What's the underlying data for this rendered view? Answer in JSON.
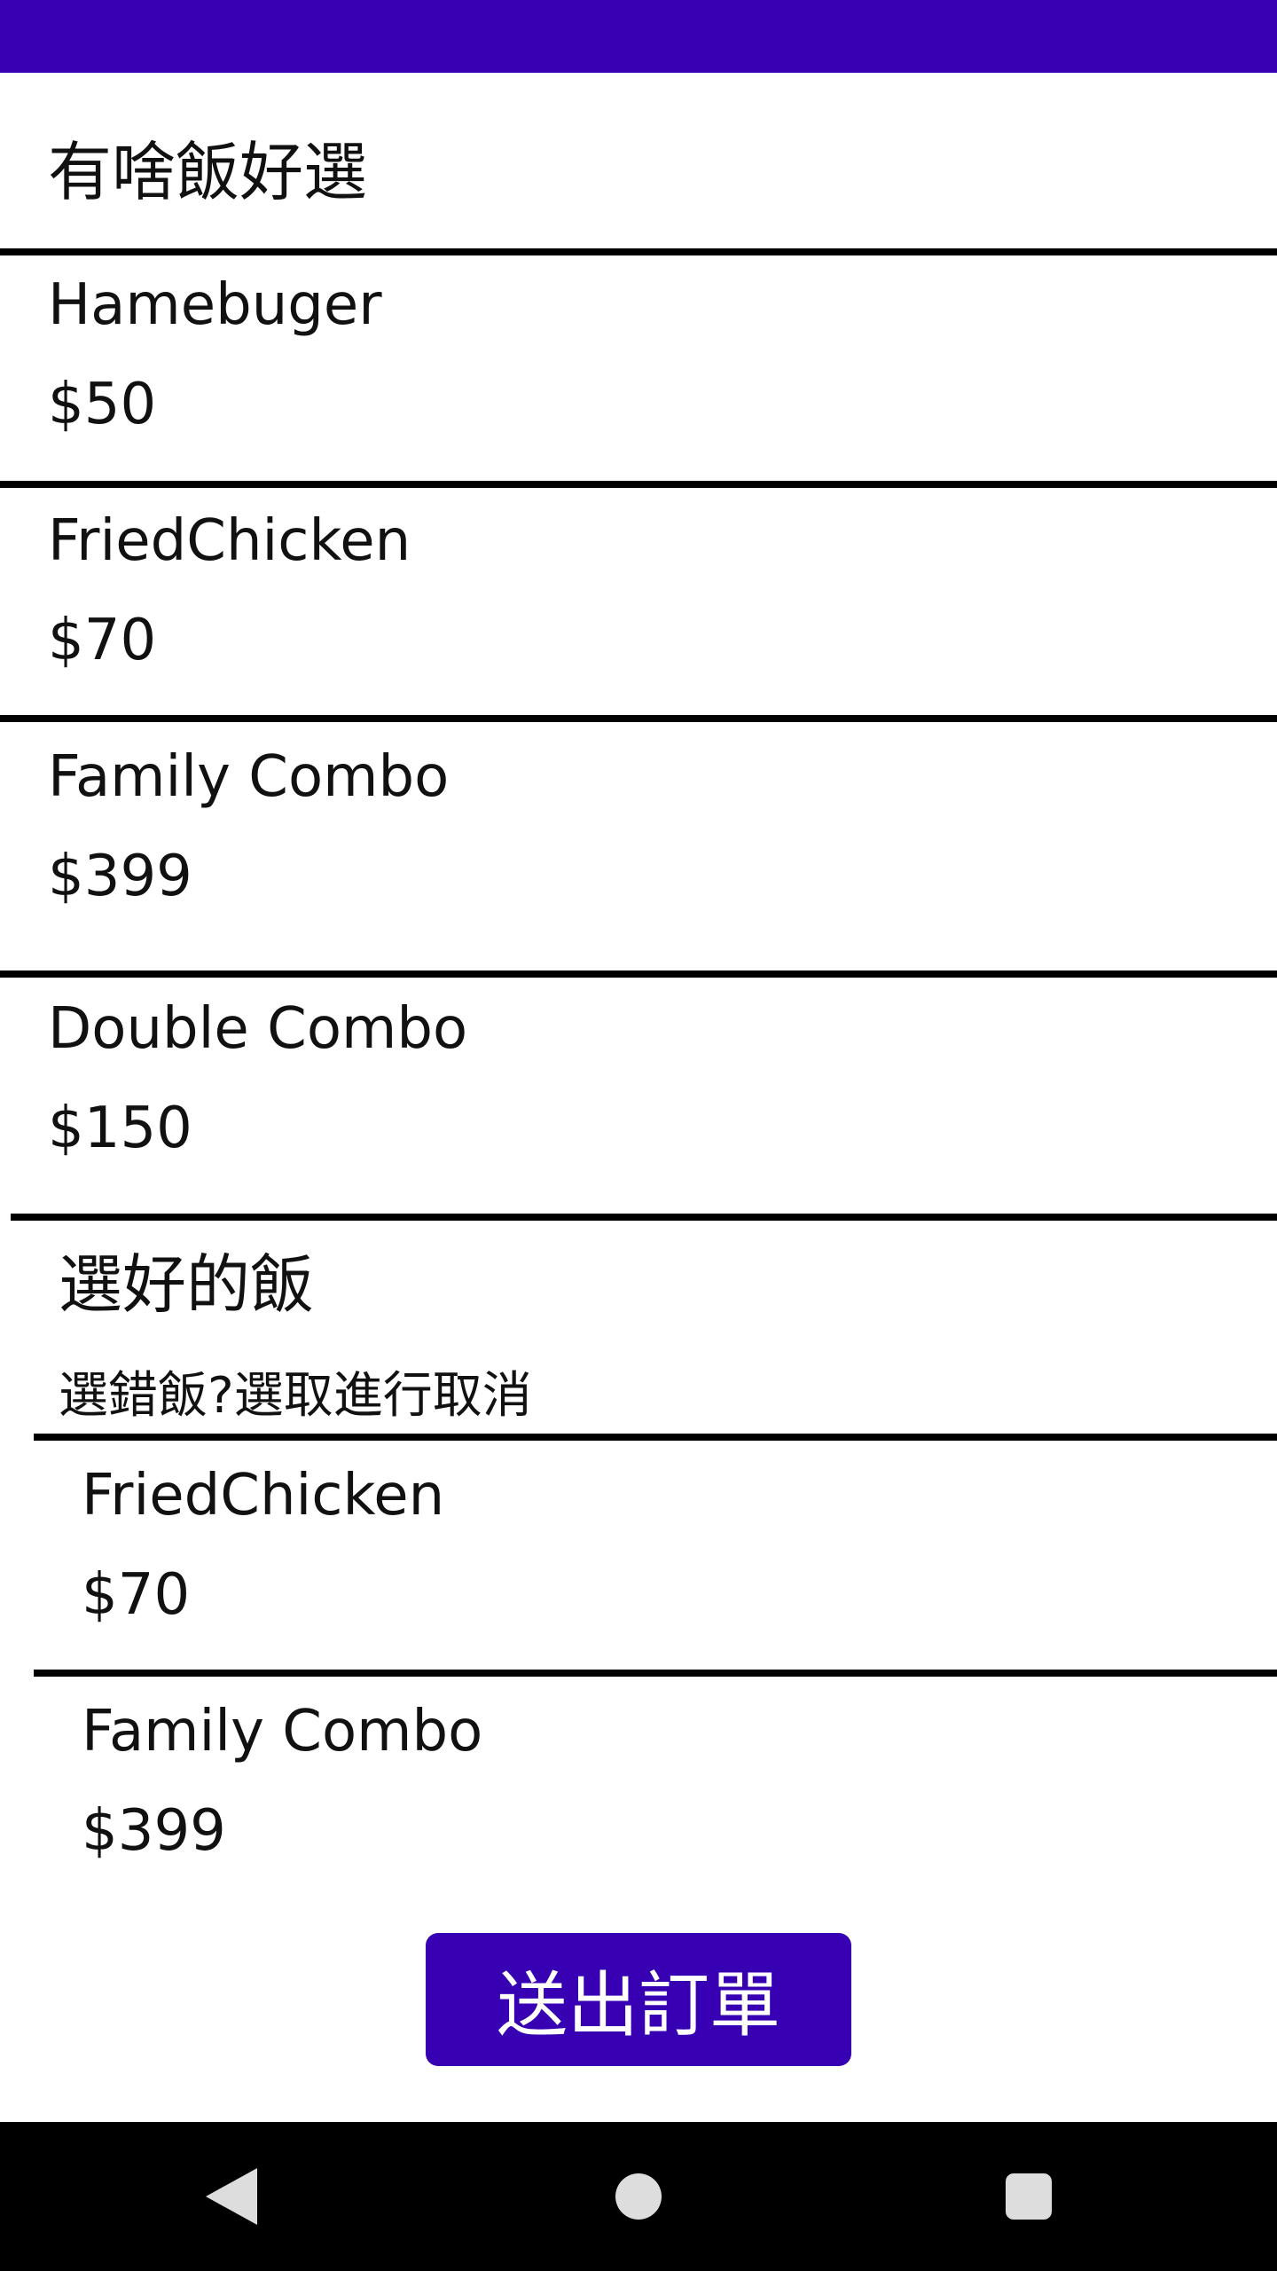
{
  "menu": {
    "title": "有啥飯好選",
    "items": [
      {
        "name": "Hamebuger",
        "price": "$50"
      },
      {
        "name": "FriedChicken",
        "price": "$70"
      },
      {
        "name": "Family Combo",
        "price": "$399"
      },
      {
        "name": "Double Combo",
        "price": "$150"
      }
    ]
  },
  "selected": {
    "title": "選好的飯",
    "hint": "選錯飯?選取進行取消",
    "items": [
      {
        "name": "FriedChicken",
        "price": "$70"
      },
      {
        "name": "Family Combo",
        "price": "$399"
      }
    ]
  },
  "actions": {
    "submit_label": "送出訂單"
  },
  "navigation": {
    "back_icon": "back-triangle-icon",
    "home_icon": "home-circle-icon",
    "recents_icon": "recents-square-icon"
  },
  "colors": {
    "accent": "#3700B3",
    "divider": "#000000",
    "nav_icon": "#dddddd"
  }
}
